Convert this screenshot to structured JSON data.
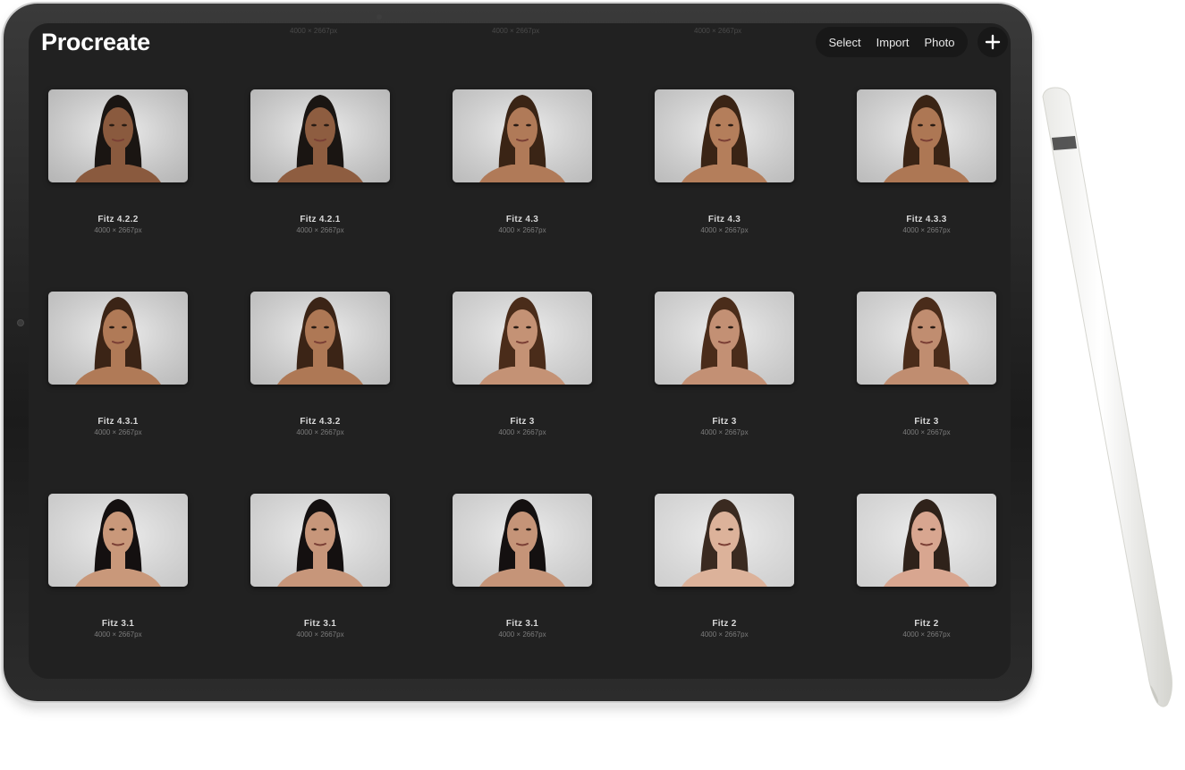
{
  "app": {
    "title": "Procreate"
  },
  "toolbar": {
    "select_label": "Select",
    "import_label": "Import",
    "photo_label": "Photo",
    "add_icon": "plus-icon"
  },
  "partial_row": {
    "dimensions": "4000 × 2667px"
  },
  "artworks": [
    {
      "title": "Fitz 4.2.2",
      "dimensions": "4000 × 2667px",
      "skin": "#8a5a3e",
      "hair": "#1a1512",
      "backdrop": "#b7b7b7"
    },
    {
      "title": "Fitz 4.2.1",
      "dimensions": "4000 × 2667px",
      "skin": "#8e5d40",
      "hair": "#1a1512",
      "backdrop": "#b7b7b7"
    },
    {
      "title": "Fitz 4.3",
      "dimensions": "4000 × 2667px",
      "skin": "#b07a58",
      "hair": "#3a2415",
      "backdrop": "#bdbdbd"
    },
    {
      "title": "Fitz 4.3",
      "dimensions": "4000 × 2667px",
      "skin": "#b47e5b",
      "hair": "#3a2415",
      "backdrop": "#bdbdbd"
    },
    {
      "title": "Fitz 4.3.3",
      "dimensions": "4000 × 2667px",
      "skin": "#ad7754",
      "hair": "#3a2415",
      "backdrop": "#bdbdbd"
    },
    {
      "title": "Fitz 4.3.1",
      "dimensions": "4000 × 2667px",
      "skin": "#b07a57",
      "hair": "#3b2416",
      "backdrop": "#bcbcbc"
    },
    {
      "title": "Fitz 4.3.2",
      "dimensions": "4000 × 2667px",
      "skin": "#ae7855",
      "hair": "#3b2416",
      "backdrop": "#bcbcbc"
    },
    {
      "title": "Fitz 3",
      "dimensions": "4000 × 2667px",
      "skin": "#c49275",
      "hair": "#4a2c1a",
      "backdrop": "#c4c4c4"
    },
    {
      "title": "Fitz 3",
      "dimensions": "4000 × 2667px",
      "skin": "#c39074",
      "hair": "#4a2c1a",
      "backdrop": "#c4c4c4"
    },
    {
      "title": "Fitz 3",
      "dimensions": "4000 × 2667px",
      "skin": "#c08d70",
      "hair": "#4a2c1a",
      "backdrop": "#c4c4c4"
    },
    {
      "title": "Fitz 3.1",
      "dimensions": "4000 × 2667px",
      "skin": "#c9987a",
      "hair": "#141010",
      "backdrop": "#c8c8c8"
    },
    {
      "title": "Fitz 3.1",
      "dimensions": "4000 × 2667px",
      "skin": "#c7967a",
      "hair": "#141010",
      "backdrop": "#c8c8c8"
    },
    {
      "title": "Fitz 3.1",
      "dimensions": "4000 × 2667px",
      "skin": "#c59478",
      "hair": "#141010",
      "backdrop": "#c8c8c8"
    },
    {
      "title": "Fitz 2",
      "dimensions": "4000 × 2667px",
      "skin": "#dcb29a",
      "hair": "#3a2a20",
      "backdrop": "#cfcfcf"
    },
    {
      "title": "Fitz 2",
      "dimensions": "4000 × 2667px",
      "skin": "#d8a690",
      "hair": "#2f221a",
      "backdrop": "#cfcfcf"
    }
  ],
  "colors": {
    "screen_bg": "#212121",
    "toolbar_bg": "#181818",
    "title_text": "#ffffff",
    "caption_text": "#d9d9d9",
    "dim_text": "#7c7c7c"
  }
}
